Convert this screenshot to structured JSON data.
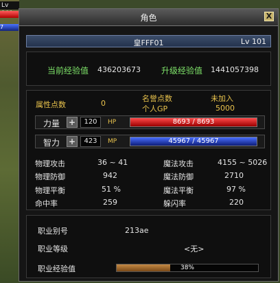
{
  "background": {
    "level_label": "Lv 101",
    "mp_fragment": "7"
  },
  "window": {
    "title": "角色",
    "close_label": "X"
  },
  "character": {
    "name": "皇FFF01",
    "level": "Lv 101"
  },
  "experience": {
    "current_label": "当前经验值",
    "current_value": "436203673",
    "next_label": "升级经验值",
    "next_value": "1441057398"
  },
  "points": {
    "attr_label": "属性点数",
    "attr_value": "0",
    "fame_label": "名誉点数",
    "personal_gp_label": "个人GP",
    "joined_label": "未加入",
    "gp_value": "5000"
  },
  "stats": {
    "strength_label": "力量",
    "strength_value": "120",
    "hp_label": "HP",
    "hp_text": "8693 / 8693",
    "hp_fraction": 1.0,
    "intellect_label": "智力",
    "intellect_value": "423",
    "mp_label": "MP",
    "mp_text": "45967 / 45967",
    "mp_fraction": 1.0
  },
  "combat": [
    {
      "label": "物理攻击",
      "value": "36 ~ 41",
      "label2": "魔法攻击",
      "value2": "4155 ~ 5026"
    },
    {
      "label": "物理防御",
      "value": "942",
      "label2": "魔法防御",
      "value2": "2710"
    },
    {
      "label": "物理平衡",
      "value": "51 %",
      "label2": "魔法平衡",
      "value2": "97 %"
    },
    {
      "label": "命中率",
      "value": "259",
      "label2": "躲闪率",
      "value2": "220"
    }
  ],
  "job": {
    "id_label": "职业别号",
    "id_value": "213ae",
    "grade_label": "职业等级",
    "grade_value": "<无>",
    "xp_label": "职业经验值",
    "xp_text": "38%",
    "xp_fraction": 0.38
  },
  "colors": {
    "label_green": "#7fe46a",
    "label_yellow": "#e9c34d",
    "hp_red": "#ff4a4a",
    "mp_blue": "#4a6fff",
    "xp_brown": "#c58a45"
  }
}
